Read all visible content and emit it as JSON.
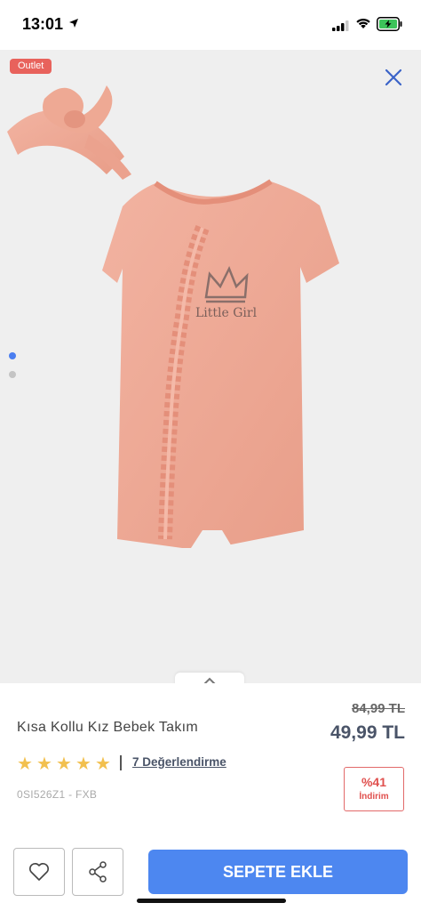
{
  "status_bar": {
    "time": "13:01"
  },
  "gallery": {
    "badge": "Outlet",
    "image_text": "Little Girl",
    "active_slide": 1,
    "slide_count": 2
  },
  "product": {
    "title": "Kısa Kollu Kız Bebek Takım",
    "old_price": "84,99 TL",
    "price": "49,99 TL",
    "rating": 5,
    "reviews": "7 Değerlendirme",
    "code": "0SI526Z1 - FXB",
    "discount": {
      "percent": "%41",
      "label": "İndirim"
    }
  },
  "actions": {
    "cart_label": "SEPETE EKLE"
  },
  "colors": {
    "accent": "#4d87f0",
    "badge": "#e8625c",
    "star": "#f2c04e",
    "discount": "#e0504e",
    "product": "#f0aa96"
  }
}
